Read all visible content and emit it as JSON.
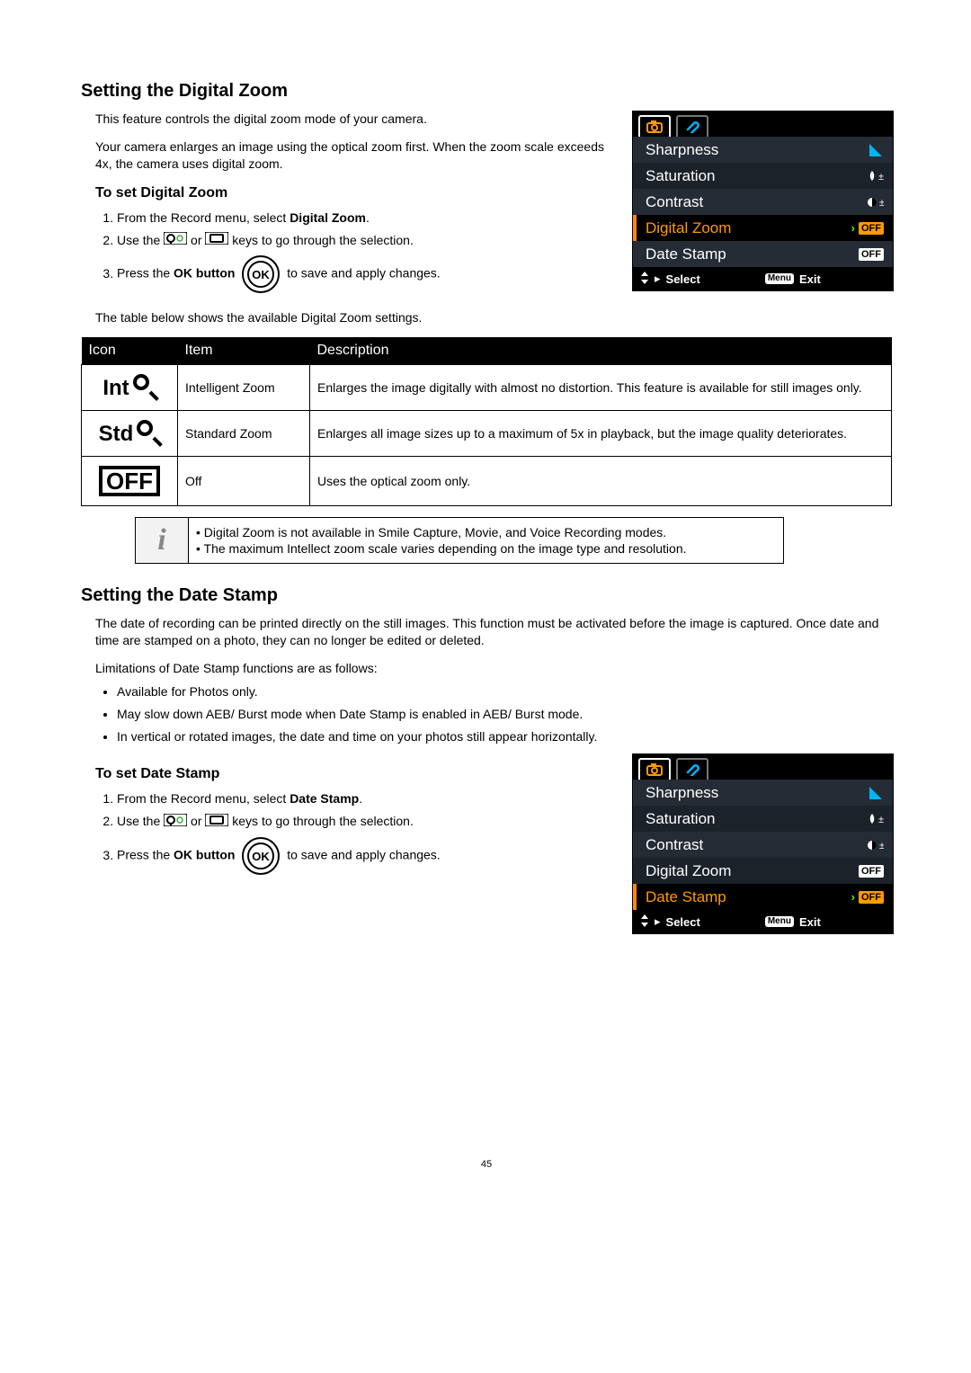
{
  "section1": {
    "heading": "Setting the Digital Zoom",
    "p1": "This feature controls the digital zoom mode of your camera.",
    "p2": "Your camera enlarges an image using the optical zoom first. When the zoom scale exceeds 4x, the camera uses digital zoom.",
    "sub": "To set Digital Zoom",
    "steps": {
      "s1a": "From the Record menu, select ",
      "s1b": "Digital Zoom",
      "s1c": ".",
      "s2a": "Use the ",
      "s2b": " or ",
      "s2c": " keys to go through the selection.",
      "s3a": "Press the ",
      "s3b": "OK button",
      "s3c": " to save and apply changes."
    },
    "table_intro": "The table below shows the available Digital Zoom settings.",
    "headers": {
      "icon": "Icon",
      "item": "Item",
      "desc": "Description"
    },
    "rows": [
      {
        "icon_word": "Int",
        "item": "Intelligent Zoom",
        "desc": "Enlarges the image digitally with almost no distortion. This feature is available for still images only."
      },
      {
        "icon_word": "Std",
        "item": "Standard Zoom",
        "desc": "Enlarges all image sizes up to a maximum of 5x in playback, but the image quality deteriorates."
      },
      {
        "icon_word": "OFF",
        "item": "Off",
        "desc": "Uses the optical zoom only."
      }
    ],
    "notes": [
      "Digital Zoom is not available in Smile Capture, Movie, and Voice Recording modes.",
      "The maximum Intellect zoom scale varies depending on the image type and resolution."
    ]
  },
  "section2": {
    "heading": "Setting the Date Stamp",
    "p1": "The date of recording can be printed directly on the still images. This function must be activated before the image is captured. Once date and time are stamped on a photo, they can no longer be edited or deleted.",
    "p2": "Limitations of Date Stamp functions are as follows:",
    "limits": [
      "Available for Photos only.",
      "May slow down AEB/ Burst mode when Date Stamp is enabled in AEB/ Burst mode.",
      "In vertical or rotated images, the date and time on your photos still appear horizontally."
    ],
    "sub": "To set Date Stamp",
    "steps": {
      "s1a": "From the Record menu, select ",
      "s1b": "Date Stamp",
      "s1c": ".",
      "s2a": "Use the ",
      "s2b": " or ",
      "s2c": " keys to go through the selection.",
      "s3a": "Press the ",
      "s3b": "OK button",
      "s3c": " to save and apply changes."
    }
  },
  "lcd": {
    "items": [
      "Sharpness",
      "Saturation",
      "Contrast",
      "Digital Zoom",
      "Date Stamp"
    ],
    "off": "OFF",
    "select": "Select",
    "menu": "Menu",
    "exit": "Exit"
  },
  "ok_label": "OK",
  "page_num": "45",
  "note_letter": "i"
}
